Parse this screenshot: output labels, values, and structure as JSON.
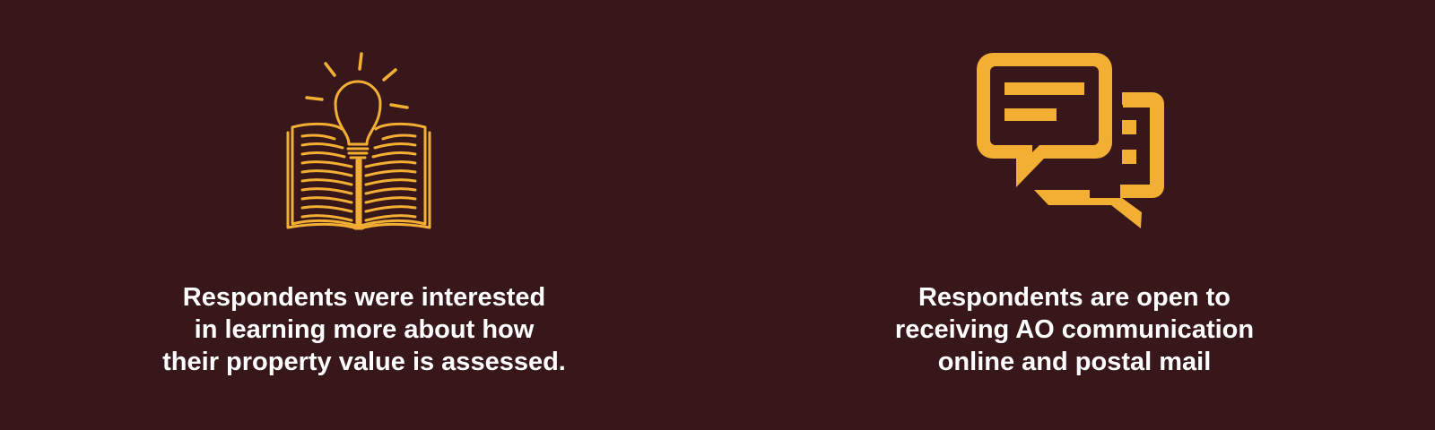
{
  "colors": {
    "background": "#371719",
    "accent": "#F2AF33",
    "text": "#FFFFFF"
  },
  "items": [
    {
      "icon": "book-lightbulb-icon",
      "lines": [
        "Respondents were interested",
        "in learning more about how",
        "their property value is assessed."
      ]
    },
    {
      "icon": "chat-bubbles-icon",
      "lines": [
        "Respondents are open to",
        "receiving AO communication",
        "online and postal mail"
      ]
    }
  ]
}
